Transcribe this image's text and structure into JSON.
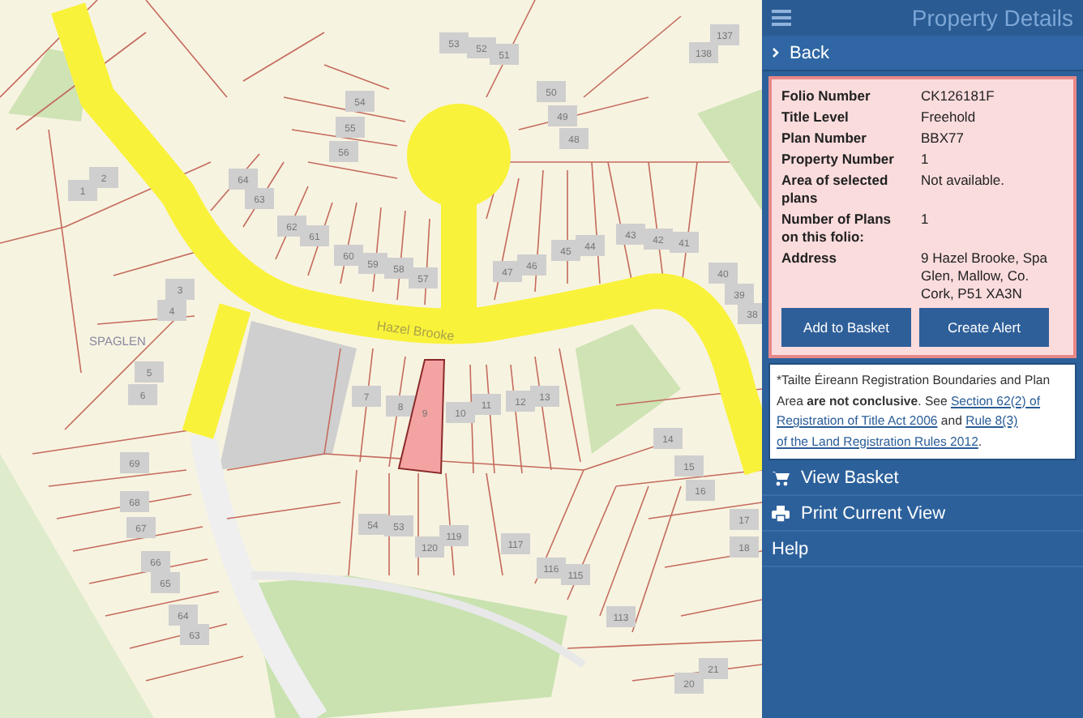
{
  "header": {
    "title": "Property Details"
  },
  "back": {
    "label": "Back"
  },
  "details": {
    "fields": [
      {
        "label": "Folio Number",
        "value": "CK126181F"
      },
      {
        "label": "Title Level",
        "value": "Freehold"
      },
      {
        "label": "Plan Number",
        "value": "BBX77"
      },
      {
        "label": "Property Number",
        "value": "1"
      },
      {
        "label": "Area of selected plans",
        "value": "Not available."
      },
      {
        "label": "Number of Plans on this folio:",
        "value": "1"
      },
      {
        "label": "Address",
        "value": "9 Hazel Brooke, Spa Glen, Mallow, Co. Cork, P51 XA3N"
      }
    ],
    "buttons": [
      "Add to Basket",
      "Create Alert"
    ]
  },
  "note": {
    "segments": [
      {
        "kind": "text",
        "text": "*Tailte Éireann Registration Boundaries and Plan Area **are not conclusive**. See "
      },
      {
        "kind": "link",
        "lines": [
          "Section 62(2) of",
          "Registration of Title Act 2006"
        ]
      },
      {
        "kind": "text",
        "text": " and "
      },
      {
        "kind": "link",
        "lines": [
          "Rule 8(3)",
          "of the Land Registration Rules 2012"
        ]
      },
      {
        "kind": "text",
        "text": "."
      }
    ]
  },
  "menu": [
    {
      "kind": "cart",
      "label": "View Basket"
    },
    {
      "kind": "printer",
      "label": "Print Current View"
    },
    {
      "kind": "plain",
      "label": "Help"
    }
  ],
  "map": {
    "street_label": "Hazel Brooke",
    "area_label": "SPAGLEN",
    "house_numbers": [
      "53",
      "52",
      "51",
      "54",
      "55",
      "56",
      "50",
      "49",
      "48",
      "64",
      "63",
      "2",
      "1",
      "62",
      "61",
      "60",
      "59",
      "58",
      "57",
      "47",
      "46",
      "45",
      "44",
      "43",
      "42",
      "41",
      "40",
      "39",
      "38",
      "3",
      "4",
      "5",
      "6",
      "7",
      "8",
      "9",
      "10",
      "11",
      "12",
      "13",
      "14",
      "15",
      "16",
      "17",
      "18",
      "69",
      "68",
      "67",
      "66",
      "65",
      "64",
      "63",
      "54",
      "53",
      "120",
      "119",
      "117",
      "116",
      "115",
      "113",
      "20",
      "21",
      "137",
      "138"
    ]
  }
}
